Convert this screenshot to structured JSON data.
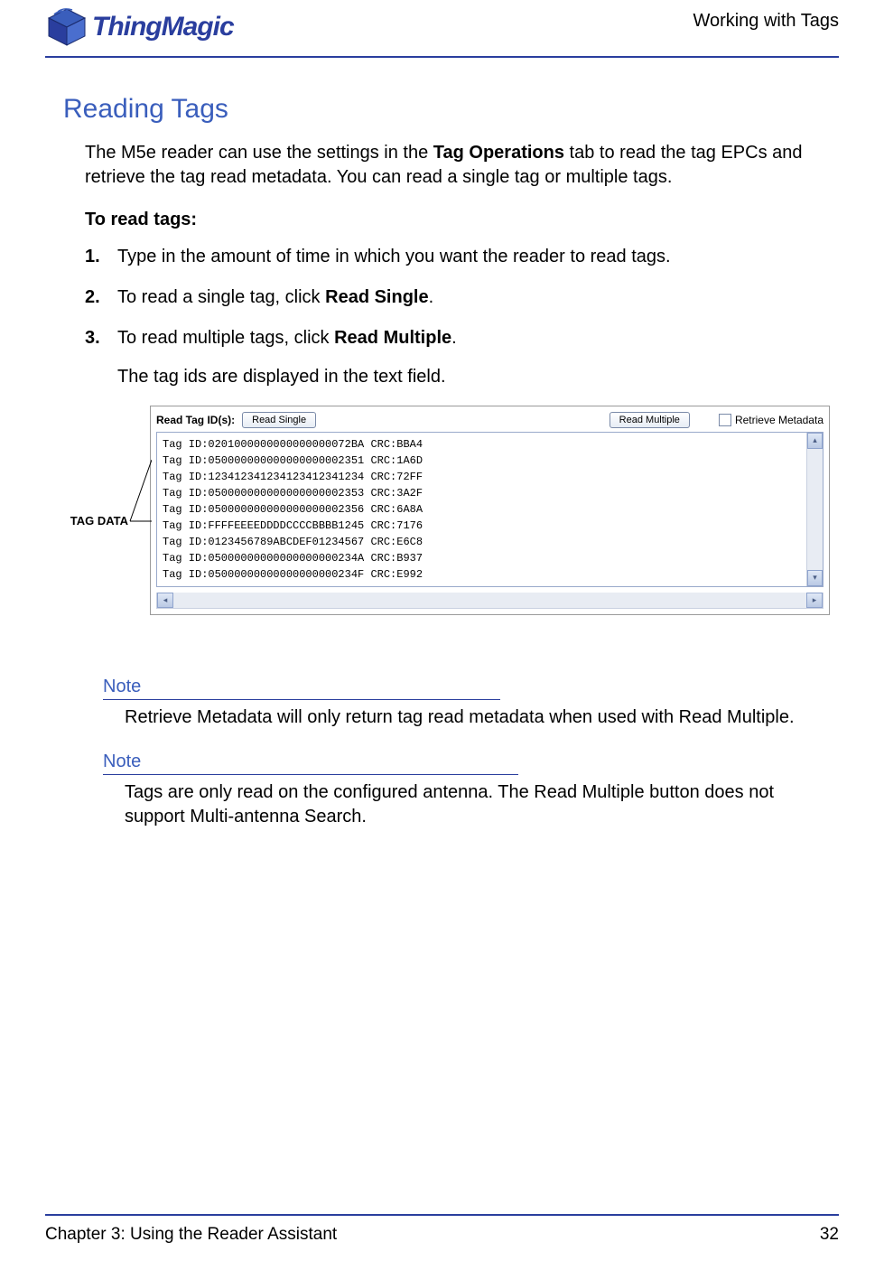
{
  "header": {
    "logo_text": "ThingMagic",
    "section_title": "Working with Tags"
  },
  "main": {
    "heading": "Reading Tags",
    "intro_pre": "The M5e reader can use the settings in the ",
    "intro_bold": "Tag Operations",
    "intro_post": " tab to read the tag EPCs and retrieve the tag read metadata. You can read a single tag or multiple tags.",
    "subhead": "To read tags:",
    "steps": [
      {
        "n": "1.",
        "pre": "Type in the amount of time in which you want the reader to read tags.",
        "bold": "",
        "post": ""
      },
      {
        "n": "2.",
        "pre": "To read a single tag, click ",
        "bold": "Read Single",
        "post": "."
      },
      {
        "n": "3.",
        "pre": "To read multiple tags, click ",
        "bold": "Read Multiple",
        "post": "."
      }
    ],
    "step3_sub": "The tag ids are displayed in the text field.",
    "annotation": "TAG DATA",
    "figure": {
      "label": "Read Tag ID(s):",
      "btn_single": "Read Single",
      "btn_multiple": "Read Multiple",
      "checkbox": "Retrieve Metadata",
      "lines": [
        "Tag ID:0201000000000000000072BA CRC:BBA4",
        "Tag ID:050000000000000000002351 CRC:1A6D",
        "Tag ID:123412341234123412341234 CRC:72FF",
        "Tag ID:050000000000000000002353 CRC:3A2F",
        "Tag ID:050000000000000000002356 CRC:6A8A",
        "Tag ID:FFFFEEEEDDDDCCCCBBBB1245 CRC:7176",
        "Tag ID:0123456789ABCDEF01234567 CRC:E6C8",
        "Tag ID:05000000000000000000234A CRC:B937",
        "Tag ID:05000000000000000000234F CRC:E992"
      ]
    },
    "notes": [
      {
        "head": "Note",
        "body": "Retrieve Metadata will only return tag read metadata when used with Read Multiple."
      },
      {
        "head": "Note",
        "body": "Tags are only read on the configured antenna. The Read Multiple button does not support Multi-antenna Search."
      }
    ]
  },
  "footer": {
    "left": "Chapter 3: Using the Reader Assistant",
    "right": "32"
  }
}
